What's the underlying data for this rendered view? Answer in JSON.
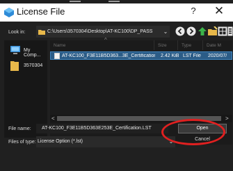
{
  "window": {
    "title": "License File",
    "help_label": "?",
    "close_label": "✕"
  },
  "toolbar": {
    "look_in_label": "Look in:",
    "path": "C:\\Users\\3570304\\Desktop\\AT-KC100\\DP_PASS",
    "icons": [
      "back-icon",
      "forward-icon",
      "up-folder-icon",
      "new-folder-icon",
      "view-grid-icon",
      "view-detail-icon"
    ]
  },
  "places": [
    {
      "label": "My Comp...",
      "icon": "computer-icon"
    },
    {
      "label": "3570304",
      "icon": "user-folder-icon"
    }
  ],
  "columns": [
    "Name",
    "Size",
    "Type",
    "Date M"
  ],
  "files": [
    {
      "name": "AT-KC100_F3E11B5D363...3E_Certification.LST",
      "size": "2.42 KiB",
      "type": "LST File",
      "date": "2020/07/"
    }
  ],
  "form": {
    "file_name_label": "File name:",
    "file_name_value": "AT-KC100_F3E11B5D363E253E_Certification.LST",
    "file_type_label": "Files of type:",
    "file_type_value": "License Option (*.lst)"
  },
  "buttons": {
    "open": "Open",
    "cancel": "Cancel"
  },
  "colors": {
    "dialog_bg": "#202020",
    "selection": "#2b5c87",
    "highlight": "#e02020"
  }
}
